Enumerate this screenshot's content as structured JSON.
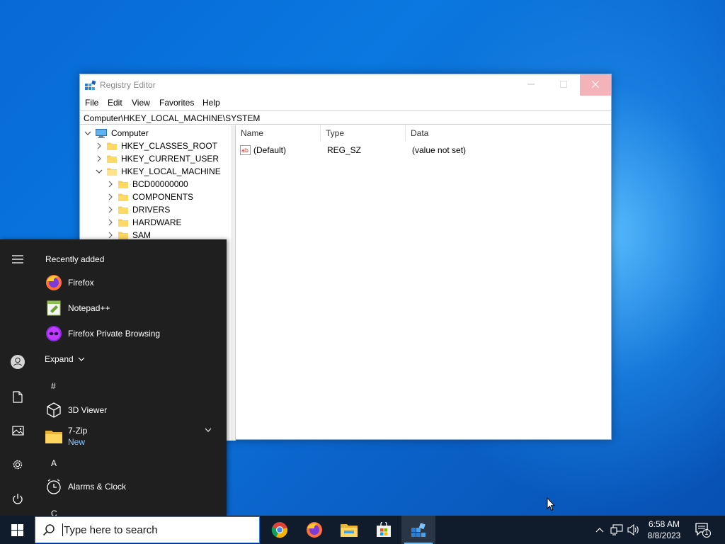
{
  "regedit": {
    "title": "Registry Editor",
    "menu": [
      "File",
      "Edit",
      "View",
      "Favorites",
      "Help"
    ],
    "address": "Computer\\HKEY_LOCAL_MACHINE\\SYSTEM",
    "tree": {
      "root": "Computer",
      "hives": [
        "HKEY_CLASSES_ROOT",
        "HKEY_CURRENT_USER",
        "HKEY_LOCAL_MACHINE"
      ],
      "hklm_children": [
        "BCD00000000",
        "COMPONENTS",
        "DRIVERS",
        "HARDWARE",
        "SAM"
      ]
    },
    "columns": [
      "Name",
      "Type",
      "Data"
    ],
    "values": [
      {
        "name": "(Default)",
        "type": "REG_SZ",
        "data": "(value not set)"
      }
    ]
  },
  "startmenu": {
    "recently_added_label": "Recently added",
    "recent_apps": [
      "Firefox",
      "Notepad++",
      "Firefox Private Browsing"
    ],
    "expand_label": "Expand",
    "section_hash": "#",
    "apps_hash": [
      {
        "name": "3D Viewer"
      },
      {
        "name": "7-Zip",
        "badge": "New"
      }
    ],
    "section_a": "A",
    "apps_a": [
      {
        "name": "Alarms & Clock"
      }
    ],
    "section_c": "C"
  },
  "taskbar": {
    "search_placeholder": "Type here to search",
    "pinned": [
      "chrome-icon",
      "firefox-icon",
      "file-explorer-icon",
      "microsoft-store-icon",
      "registry-editor-icon"
    ],
    "time": "6:58 AM",
    "date": "8/8/2023",
    "notification_count": "1"
  }
}
